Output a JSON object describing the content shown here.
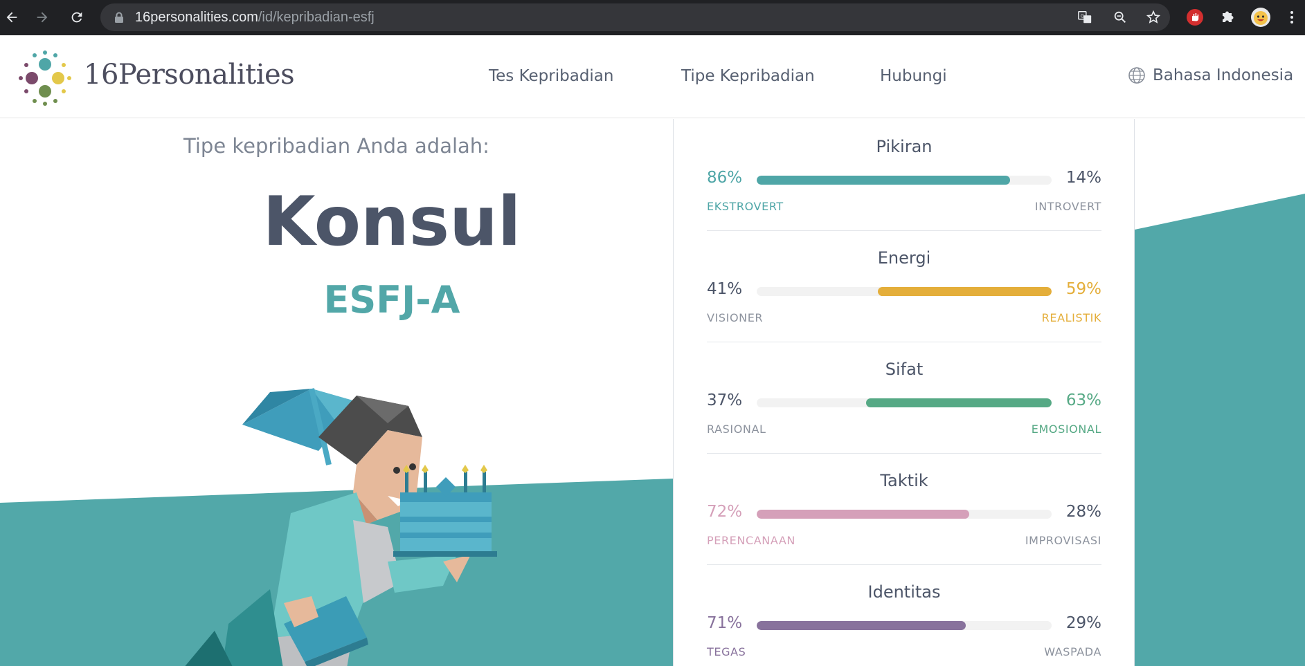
{
  "browser": {
    "url_host": "16personalities.com",
    "url_path": "/id/kepribadian-esfj"
  },
  "header": {
    "logo_text": "16Personalities",
    "nav": [
      "Tes Kepribadian",
      "Tipe Kepribadian",
      "Hubungi"
    ],
    "language": "Bahasa Indonesia"
  },
  "result": {
    "intro": "Tipe kepribadian Anda adalah:",
    "type_name": "Konsul",
    "type_code": "ESFJ-A"
  },
  "traits": [
    {
      "title": "Pikiran",
      "left_pct": "86%",
      "right_pct": "14%",
      "left_label": "EKSTROVERT",
      "right_label": "INTROVERT",
      "dominant": "left",
      "fill_fraction": 0.86,
      "color": "#4fa6a7"
    },
    {
      "title": "Energi",
      "left_pct": "41%",
      "right_pct": "59%",
      "left_label": "VISIONER",
      "right_label": "REALISTIK",
      "dominant": "right",
      "fill_fraction": 0.59,
      "color": "#e4ae3a"
    },
    {
      "title": "Sifat",
      "left_pct": "37%",
      "right_pct": "63%",
      "left_label": "RASIONAL",
      "right_label": "EMOSIONAL",
      "dominant": "right",
      "fill_fraction": 0.63,
      "color": "#56a985"
    },
    {
      "title": "Taktik",
      "left_pct": "72%",
      "right_pct": "28%",
      "left_label": "PERENCANAAN",
      "right_label": "IMPROVISASI",
      "dominant": "left",
      "fill_fraction": 0.72,
      "color": "#d5a0b9"
    },
    {
      "title": "Identitas",
      "left_pct": "71%",
      "right_pct": "29%",
      "left_label": "TEGAS",
      "right_label": "WASPADA",
      "dominant": "left",
      "fill_fraction": 0.71,
      "color": "#88729c"
    }
  ],
  "colors": {
    "teal": "#52a8a9",
    "text_dark": "#4c5568",
    "text_muted": "#8d939e"
  }
}
